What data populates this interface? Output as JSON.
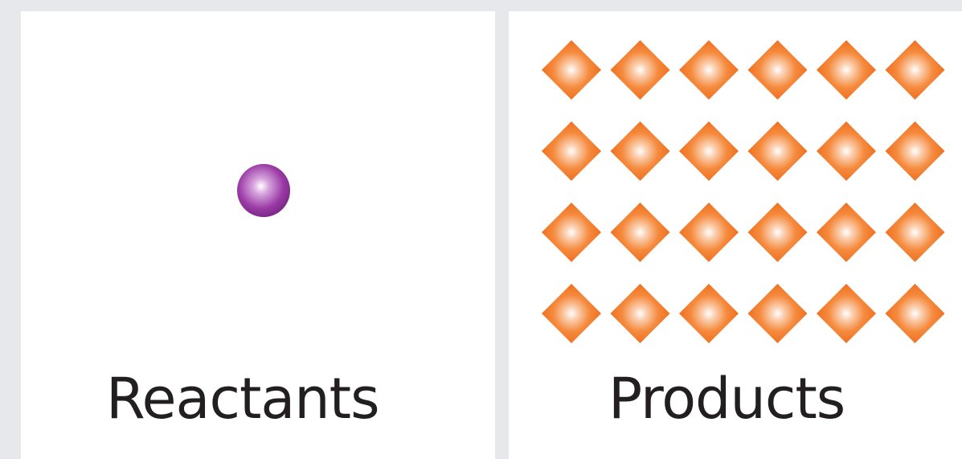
{
  "panels": [
    {
      "label": "Reactants",
      "particle_count": 1,
      "particle_shape": "sphere",
      "particle_color": "#8e2f9a"
    },
    {
      "label": "Products",
      "particle_count": 24,
      "grid_rows": 4,
      "grid_cols": 6,
      "particle_shape": "diamond",
      "particle_color": "#f37021"
    }
  ],
  "colors": {
    "background": "#e6e8ec",
    "panel": "#ffffff",
    "text": "#231f20"
  }
}
